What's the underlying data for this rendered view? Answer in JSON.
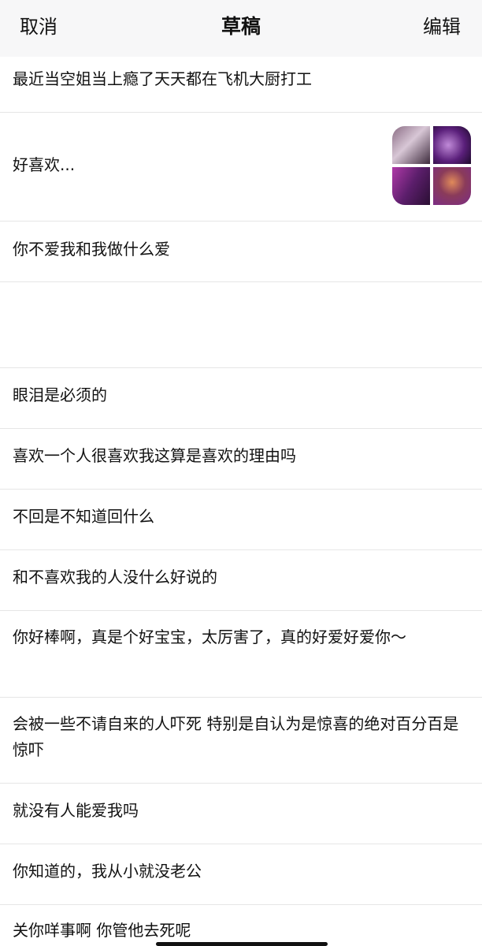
{
  "navbar": {
    "cancel_label": "取消",
    "title": "草稿",
    "edit_label": "编辑"
  },
  "drafts": [
    "最近当空姐当上瘾了天天都在飞机大厨打工",
    "好喜欢...",
    "你不爱我和我做什么爱",
    "",
    "眼泪是必须的",
    "喜欢一个人很喜欢我这算是喜欢的理由吗",
    "不回是不知道回什么",
    "和不喜欢我的人没什么好说的",
    "你好棒啊，真是个好宝宝，太厉害了，真的好爱好爱你～",
    "会被一些不请自来的人吓死 特别是自认为是惊喜的绝对百分百是惊吓",
    "就没有人能爱我吗",
    "你知道的，我从小就没老公",
    "关你咩事啊 你管他去死呢"
  ]
}
